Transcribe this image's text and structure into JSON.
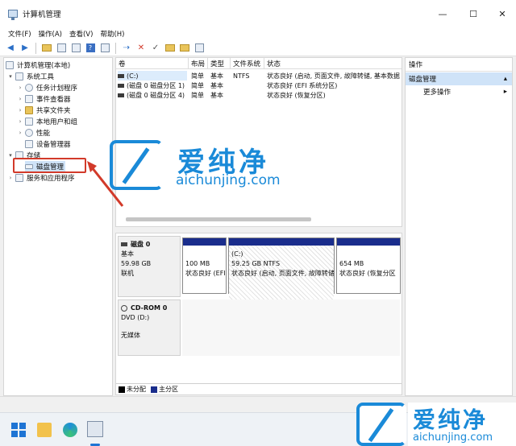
{
  "window": {
    "title": "计算机管理",
    "min": "—",
    "max": "☐",
    "close": "✕"
  },
  "menu": [
    "文件(F)",
    "操作(A)",
    "查看(V)",
    "帮助(H)"
  ],
  "tree": {
    "root": "计算机管理(本地)",
    "system_tools": "系统工具",
    "task_scheduler": "任务计划程序",
    "event_viewer": "事件查看器",
    "shared_folders": "共享文件夹",
    "local_users": "本地用户和组",
    "performance": "性能",
    "device_manager": "设备管理器",
    "storage": "存储",
    "disk_management": "磁盘管理",
    "services_apps": "服务和应用程序"
  },
  "columns": [
    "卷",
    "布局",
    "类型",
    "文件系统",
    "状态"
  ],
  "volumes": [
    {
      "name": "(C:)",
      "layout": "简单",
      "type": "基本",
      "fs": "NTFS",
      "status": "状态良好 (启动, 页面文件, 故障转储, 基本数据"
    },
    {
      "name": "(磁盘 0 磁盘分区 1)",
      "layout": "简单",
      "type": "基本",
      "fs": "",
      "status": "状态良好 (EFI 系统分区)"
    },
    {
      "name": "(磁盘 0 磁盘分区 4)",
      "layout": "简单",
      "type": "基本",
      "fs": "",
      "status": "状态良好 (恢复分区)"
    }
  ],
  "disk0": {
    "name": "磁盘 0",
    "kind": "基本",
    "size": "59.98 GB",
    "state": "联机",
    "partitions": [
      {
        "label": "",
        "size": "100 MB",
        "status": "状态良好 (EFI"
      },
      {
        "label": "(C:)",
        "size": "59.25 GB NTFS",
        "status": "状态良好 (启动, 页面文件, 故障转储"
      },
      {
        "label": "",
        "size": "654 MB",
        "status": "状态良好 (恢复分区"
      }
    ]
  },
  "cdrom": {
    "name": "CD-ROM 0",
    "drive": "DVD (D:)",
    "media": "无媒体"
  },
  "legend": [
    {
      "label": "未分配",
      "color": "#000000"
    },
    {
      "label": "主分区",
      "color": "#1a2d8c"
    }
  ],
  "actions": {
    "header": "操作",
    "section": "磁盘管理",
    "more": "更多操作"
  },
  "watermark": {
    "brand": "爱纯净",
    "url": "aichunjing.com"
  },
  "colors": {
    "accent": "#1a8ad8",
    "highlight": "#d23a2a",
    "selection": "#cfe3f8",
    "partition_bar": "#1a2d8c"
  }
}
